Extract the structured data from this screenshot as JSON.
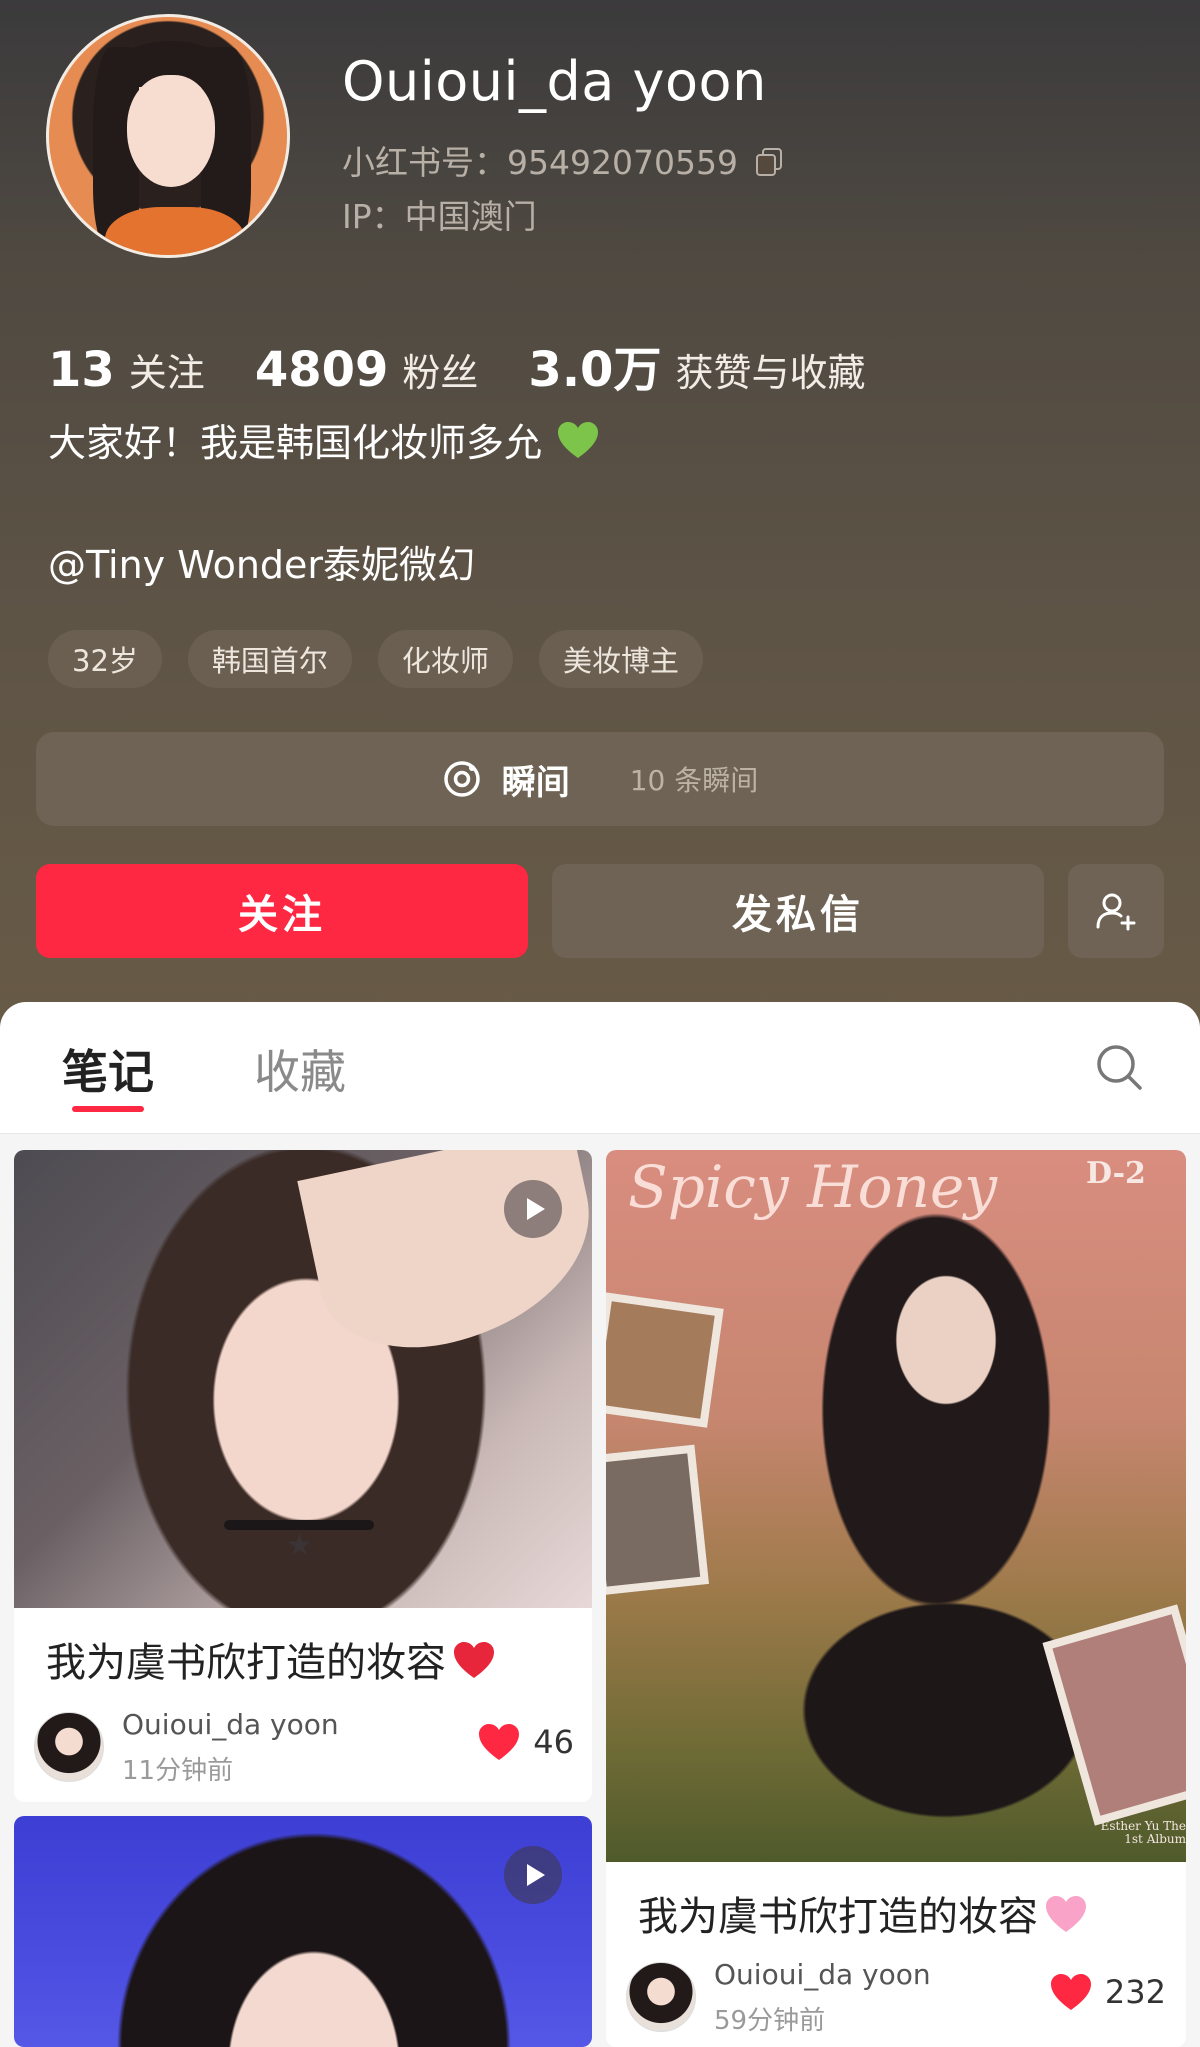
{
  "profile": {
    "name": "Ouioui_da yoon",
    "red_id": "小红书号：95492070559",
    "ip": "IP：中国澳门",
    "stats": [
      {
        "num": "13",
        "label": "关注"
      },
      {
        "num": "4809",
        "label": "粉丝"
      },
      {
        "num": "3.0万",
        "label": "获赞与收藏"
      }
    ],
    "bio": "大家好！我是韩国化妆师多允",
    "mention": "@Tiny Wonder泰妮微幻",
    "tags": [
      "32岁",
      "韩国首尔",
      "化妆师",
      "美妆博主"
    ]
  },
  "moments": {
    "title": "瞬间",
    "count": "10 条瞬间"
  },
  "actions": {
    "follow": "关注",
    "message": "发私信"
  },
  "tabs": {
    "notes": "笔记",
    "collect": "收藏"
  },
  "notes": [
    {
      "title": "我为虞书欣打造的妆容",
      "author": "Ouioui_da yoon",
      "time": "11分钟前",
      "likes": "46"
    },
    {
      "title": "我为虞书欣打造的妆容",
      "author": "Ouioui_da yoon",
      "time": "59分钟前",
      "likes": "232",
      "image_text": {
        "script": "Spicy Honey",
        "badge": "D-2",
        "album": "Esther Yu The 1st Album"
      }
    }
  ],
  "colors": {
    "accent": "#fe2843",
    "header_bg": "#5e5446",
    "button_bg": "#6e6354"
  }
}
